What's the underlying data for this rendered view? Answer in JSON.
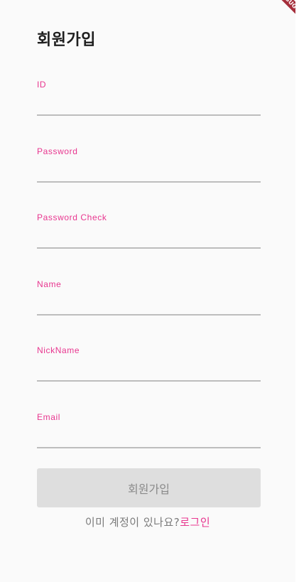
{
  "header": {
    "title": "회원가입"
  },
  "form": {
    "fields": [
      {
        "label": "ID",
        "value": ""
      },
      {
        "label": "Password",
        "value": ""
      },
      {
        "label": "Password Check",
        "value": ""
      },
      {
        "label": "Name",
        "value": ""
      },
      {
        "label": "NickName",
        "value": ""
      },
      {
        "label": "Email",
        "value": ""
      }
    ],
    "submit_label": "회원가입"
  },
  "footer": {
    "prompt": "이미 계정이 있나요?",
    "login_link": "로그인"
  },
  "debug_banner": "DEBUG",
  "colors": {
    "accent": "#e8368f",
    "button_disabled_bg": "#dedede",
    "button_disabled_text": "#8a8a8a",
    "underline": "#bdbdbd",
    "background": "#fafafa"
  }
}
